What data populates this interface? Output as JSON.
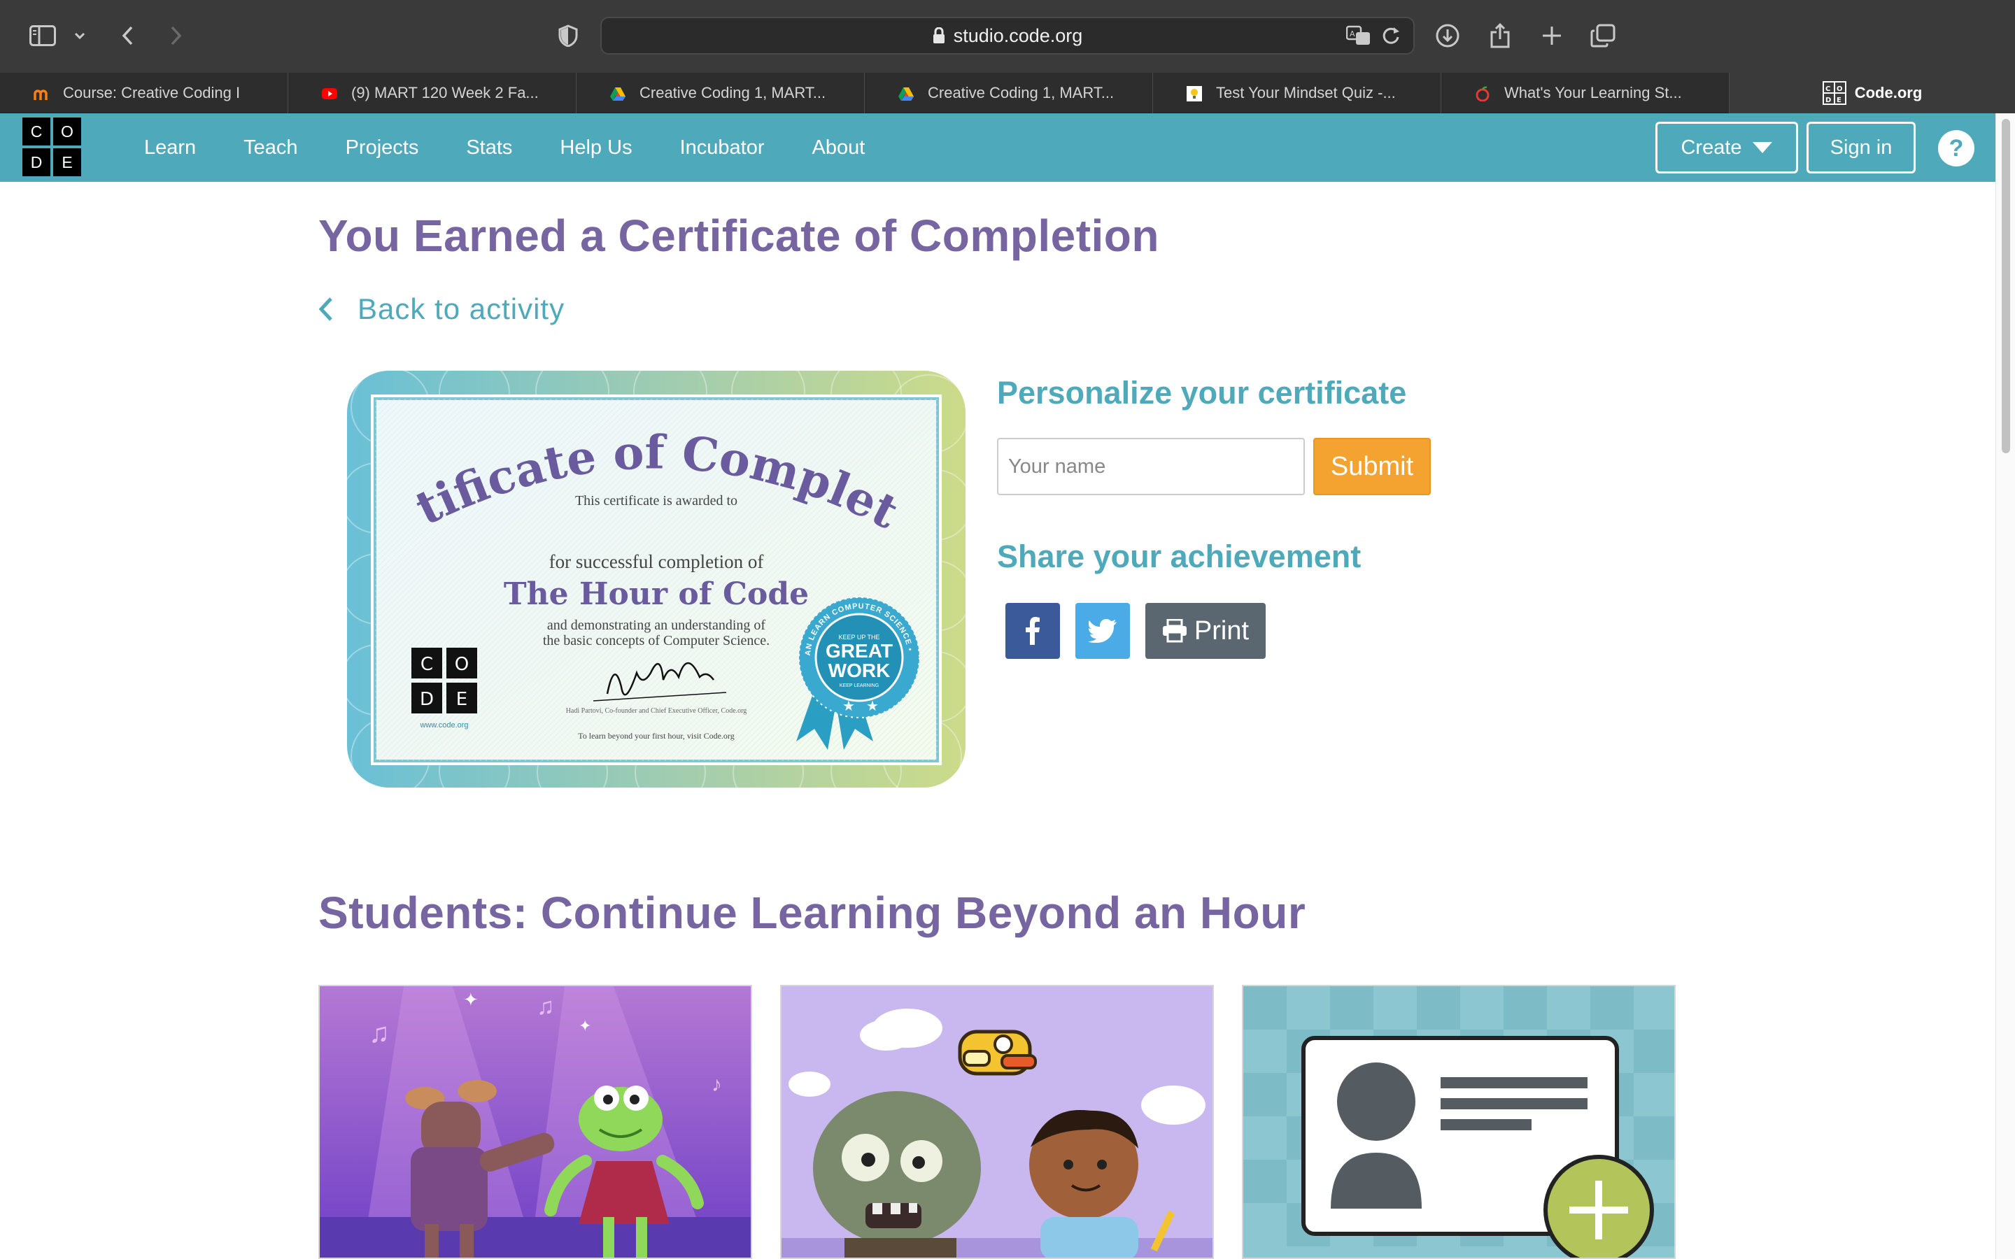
{
  "browser": {
    "url": "studio.code.org",
    "tabs": [
      {
        "label": "Course: Creative Coding I",
        "favicon": "moodle-icon"
      },
      {
        "label": "(9) MART 120 Week 2 Fa...",
        "favicon": "youtube-icon"
      },
      {
        "label": "Creative Coding 1, MART...",
        "favicon": "drive-icon"
      },
      {
        "label": "Creative Coding 1, MART...",
        "favicon": "drive-icon"
      },
      {
        "label": "Test Your Mindset Quiz -...",
        "favicon": "lightbulb-icon"
      },
      {
        "label": "What's Your Learning St...",
        "favicon": "apple-icon"
      },
      {
        "label": "Code.org",
        "favicon": "code-org-icon",
        "active": true
      }
    ]
  },
  "nav": {
    "logo_letters": [
      "C",
      "O",
      "D",
      "E"
    ],
    "links": [
      "Learn",
      "Teach",
      "Projects",
      "Stats",
      "Help Us",
      "Incubator",
      "About"
    ],
    "create_label": "Create",
    "signin_label": "Sign in",
    "help_label": "?"
  },
  "page": {
    "title": "You Earned a Certificate of Completion",
    "back_label": "Back to activity",
    "certificate": {
      "heading": "Certificate of Completion",
      "awarded": "This certificate is awarded to",
      "for_line": "for successful completion of",
      "course": "The Hour of Code",
      "demo_line1": "and demonstrating an understanding of",
      "demo_line2": "the basic concepts of Computer Science.",
      "signature": "Hadi Partovi",
      "signer": "Hadi Partovi, Co-founder and Chief Executive Officer, Code.org",
      "footer": "To learn beyond your first hour, visit Code.org",
      "site": "www.code.org",
      "badge_big1": "GREAT",
      "badge_big2": "WORK",
      "badge_top": "KEEP UP THE",
      "badge_bottom": "KEEP LEARNING",
      "badge_ring": "ANYONE CAN LEARN COMPUTER SCIENCE • CODE.ORG"
    },
    "personalize_heading": "Personalize your certificate",
    "name_placeholder": "Your name",
    "submit_label": "Submit",
    "share_heading": "Share your achievement",
    "print_label": "Print",
    "students_heading": "Students: Continue Learning Beyond an Hour"
  },
  "colors": {
    "nav_bg": "#4ea9bb",
    "heading_purple": "#7665a0",
    "teal": "#4ea9bb",
    "submit_orange": "#f4a330",
    "facebook": "#3b5a9a",
    "twitter": "#4aabe7",
    "print_gray": "#5b6770"
  }
}
